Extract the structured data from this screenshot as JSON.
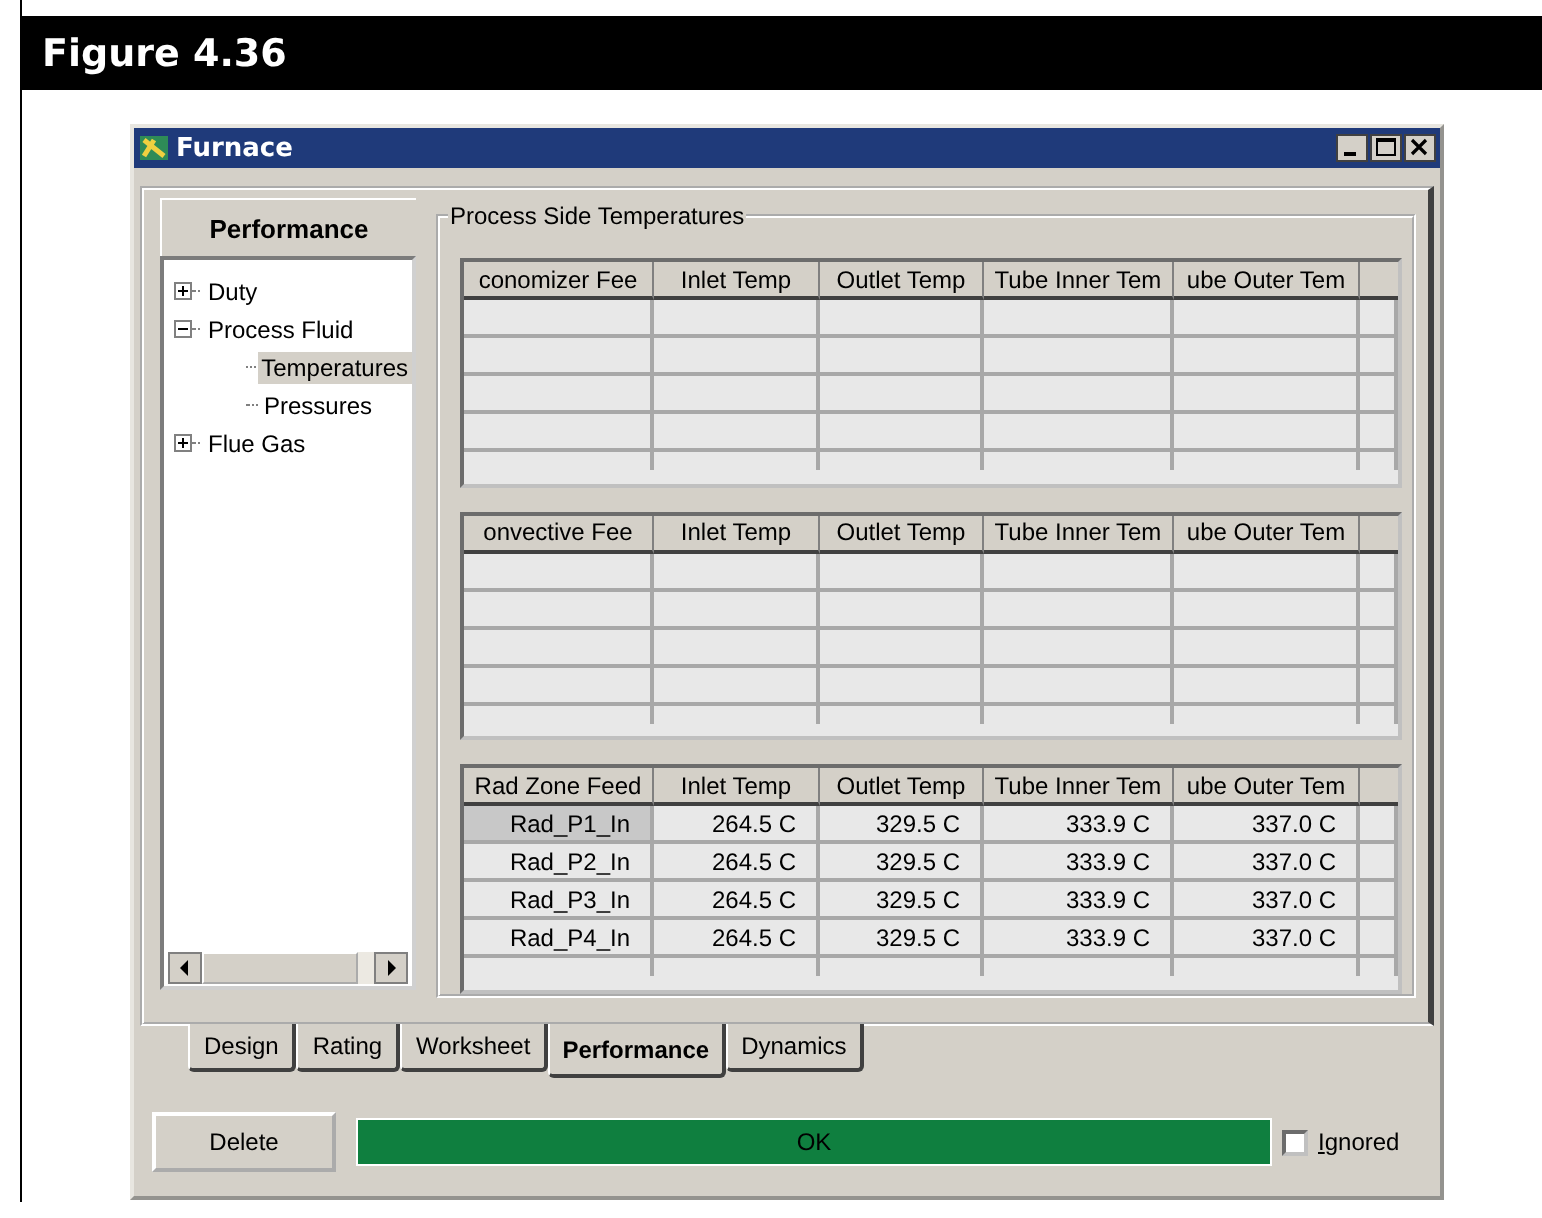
{
  "figure": {
    "title": "Figure 4.36"
  },
  "window": {
    "title": "Furnace"
  },
  "tree": {
    "title": "Performance",
    "items": [
      {
        "label": "Duty",
        "expanded": false,
        "selected": false
      },
      {
        "label": "Process Fluid",
        "expanded": true,
        "selected": false,
        "children": [
          {
            "label": "Temperatures",
            "selected": true
          },
          {
            "label": "Pressures",
            "selected": false
          }
        ]
      },
      {
        "label": "Flue Gas",
        "expanded": false,
        "selected": false
      }
    ]
  },
  "group": {
    "title": "Process Side Temperatures",
    "tables": [
      {
        "columns": [
          "conomizer Fee",
          "Inlet Temp",
          "Outlet Temp",
          "Tube Inner Tem",
          "ube Outer Tem"
        ]
      },
      {
        "columns": [
          "onvective Fee",
          "Inlet Temp",
          "Outlet Temp",
          "Tube Inner Tem",
          "ube Outer Tem"
        ]
      },
      {
        "columns": [
          "Rad Zone Feed",
          "Inlet Temp",
          "Outlet Temp",
          "Tube Inner Tem",
          "ube Outer Tem"
        ],
        "rows": [
          {
            "selected": true,
            "cells": [
              "Rad_P1_In",
              "264.5 C",
              "329.5 C",
              "333.9 C",
              "337.0 C"
            ]
          },
          {
            "selected": false,
            "cells": [
              "Rad_P2_In",
              "264.5 C",
              "329.5 C",
              "333.9 C",
              "337.0 C"
            ]
          },
          {
            "selected": false,
            "cells": [
              "Rad_P3_In",
              "264.5 C",
              "329.5 C",
              "333.9 C",
              "337.0 C"
            ]
          },
          {
            "selected": false,
            "cells": [
              "Rad_P4_In",
              "264.5 C",
              "329.5 C",
              "333.9 C",
              "337.0 C"
            ]
          }
        ]
      }
    ]
  },
  "tabs": [
    {
      "label": "Design",
      "selected": false
    },
    {
      "label": "Rating",
      "selected": false
    },
    {
      "label": "Worksheet",
      "selected": false
    },
    {
      "label": "Performance",
      "selected": true
    },
    {
      "label": "Dynamics",
      "selected": false
    }
  ],
  "delete_button": "Delete",
  "status": {
    "text": "OK"
  },
  "ignored": {
    "label": "Ignored",
    "checked": false
  }
}
